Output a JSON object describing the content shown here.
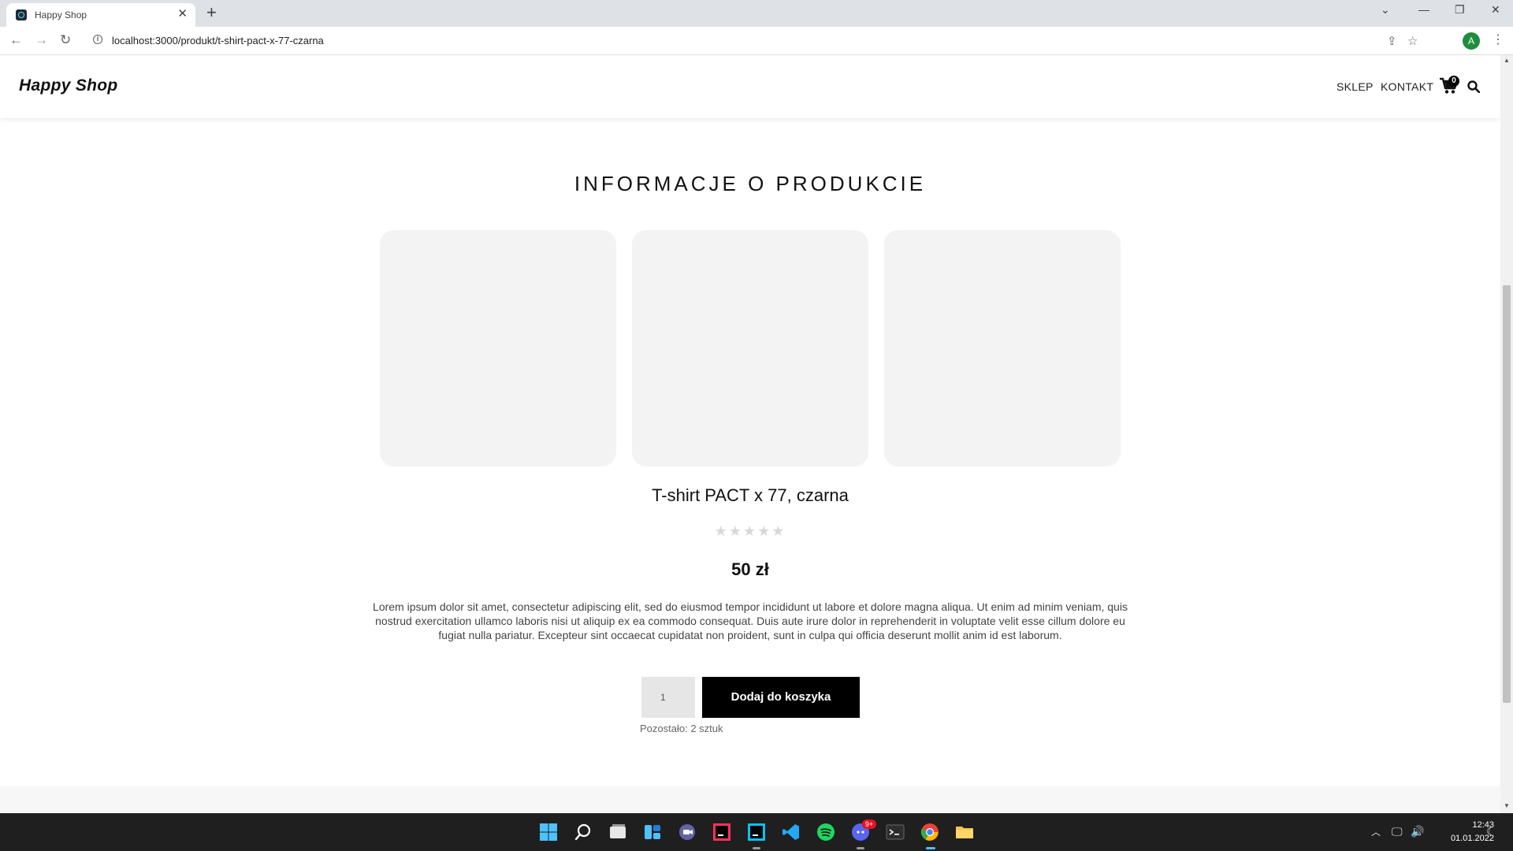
{
  "browser": {
    "tab_title": "Happy Shop",
    "tab_close": "✕",
    "new_tab": "+",
    "url": "localhost:3000/produkt/t-shirt-pact-x-77-czarna",
    "profile_initial": "A"
  },
  "site": {
    "logo": "Happy Shop",
    "nav": [
      "SKLEP",
      "KONTAKT"
    ],
    "cart_count": "0"
  },
  "product": {
    "section_title": "INFORMACJE O PRODUKCIE",
    "name": "T-shirt PACT x 77, czarna",
    "rating_stars": "★★★★★",
    "rating_value": 0,
    "rating_max": 5,
    "price": "50 zł",
    "description": "Lorem ipsum dolor sit amet, consectetur adipiscing elit, sed do eiusmod tempor incididunt ut labore et dolore magna aliqua. Ut enim ad minim veniam, quis nostrud exercitation ullamco laboris nisi ut aliquip ex ea commodo consequat. Duis aute irure dolor in reprehenderit in voluptate velit esse cillum dolore eu fugiat nulla pariatur. Excepteur sint occaecat cupidatat non proident, sunt in culpa qui officia deserunt mollit anim id est laborum.",
    "quantity": "1",
    "add_to_cart": "Dodaj do koszyka",
    "stock": "Pozostało: 2 sztuk"
  },
  "taskbar": {
    "time": "12:43",
    "date": "01.01.2022",
    "discord_badge": "9+"
  },
  "colors": {
    "accent": "#000000",
    "tile": "#f3f3f3",
    "star_empty": "#d8d8d8"
  }
}
